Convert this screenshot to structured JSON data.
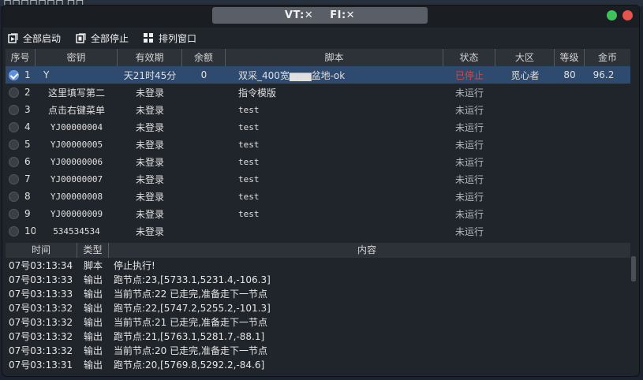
{
  "background": {
    "label": "口口口口口口口 口口"
  },
  "titlebar": {
    "vt_label": "VT:✕",
    "fi_label": "FI:✕"
  },
  "toolbar": {
    "start_all": "全部启动",
    "stop_all": "全部停止",
    "arrange": "排列窗口"
  },
  "table": {
    "headers": [
      "序号",
      "密钥",
      "有效期",
      "余额",
      "脚本",
      "状态",
      "大区",
      "等级",
      "金币"
    ],
    "rows": [
      {
        "no": "1",
        "key": "Y",
        "expiry": "天21时45分",
        "balance": "0",
        "script": "双采_400宽▆▆▆盆地-ok",
        "state": "已停止",
        "region": "觅心者",
        "level": "80",
        "gold": "96.2",
        "selected": true
      },
      {
        "no": "2",
        "key": "这里填写第二",
        "expiry": "未登录",
        "balance": "",
        "script": "指令模版",
        "state": "未运行",
        "region": "",
        "level": "",
        "gold": ""
      },
      {
        "no": "3",
        "key": "点击右键菜单",
        "expiry": "未登录",
        "balance": "",
        "script": "test",
        "state": "未运行",
        "region": "",
        "level": "",
        "gold": ""
      },
      {
        "no": "4",
        "key": "YJ00000004",
        "expiry": "未登录",
        "balance": "",
        "script": "test",
        "state": "未运行",
        "region": "",
        "level": "",
        "gold": ""
      },
      {
        "no": "5",
        "key": "YJ00000005",
        "expiry": "未登录",
        "balance": "",
        "script": "test",
        "state": "未运行",
        "region": "",
        "level": "",
        "gold": ""
      },
      {
        "no": "6",
        "key": "YJ00000006",
        "expiry": "未登录",
        "balance": "",
        "script": "test",
        "state": "未运行",
        "region": "",
        "level": "",
        "gold": ""
      },
      {
        "no": "7",
        "key": "YJ00000007",
        "expiry": "未登录",
        "balance": "",
        "script": "test",
        "state": "未运行",
        "region": "",
        "level": "",
        "gold": ""
      },
      {
        "no": "8",
        "key": "YJ00000008",
        "expiry": "未登录",
        "balance": "",
        "script": "test",
        "state": "未运行",
        "region": "",
        "level": "",
        "gold": ""
      },
      {
        "no": "9",
        "key": "YJ00000009",
        "expiry": "未登录",
        "balance": "",
        "script": "test",
        "state": "未运行",
        "region": "",
        "level": "",
        "gold": ""
      },
      {
        "no": "10",
        "key": "534534534",
        "expiry": "未登录",
        "balance": "",
        "script": "",
        "state": "未运行",
        "region": "",
        "level": "",
        "gold": ""
      }
    ]
  },
  "log": {
    "headers": [
      "时间",
      "类型",
      "内容"
    ],
    "rows": [
      {
        "time": "07号03:13:34",
        "type": "脚本",
        "msg": "停止执行!"
      },
      {
        "time": "07号03:13:33",
        "type": "输出",
        "msg": "跑节点:23,[5733.1,5231.4,-106.3]"
      },
      {
        "time": "07号03:13:33",
        "type": "输出",
        "msg": "当前节点:22 已走完,准备走下一节点"
      },
      {
        "time": "07号03:13:32",
        "type": "输出",
        "msg": "跑节点:22,[5747.2,5255.2,-101.3]"
      },
      {
        "time": "07号03:13:32",
        "type": "输出",
        "msg": "当前节点:21 已走完,准备走下一节点"
      },
      {
        "time": "07号03:13:32",
        "type": "输出",
        "msg": "跑节点:21,[5763.1,5281.7,-88.1]"
      },
      {
        "time": "07号03:13:32",
        "type": "输出",
        "msg": "当前节点:20 已走完,准备走下一节点"
      },
      {
        "time": "07号03:13:31",
        "type": "输出",
        "msg": "跑节点:20,[5769.8,5292.2,-84.6]"
      }
    ]
  }
}
